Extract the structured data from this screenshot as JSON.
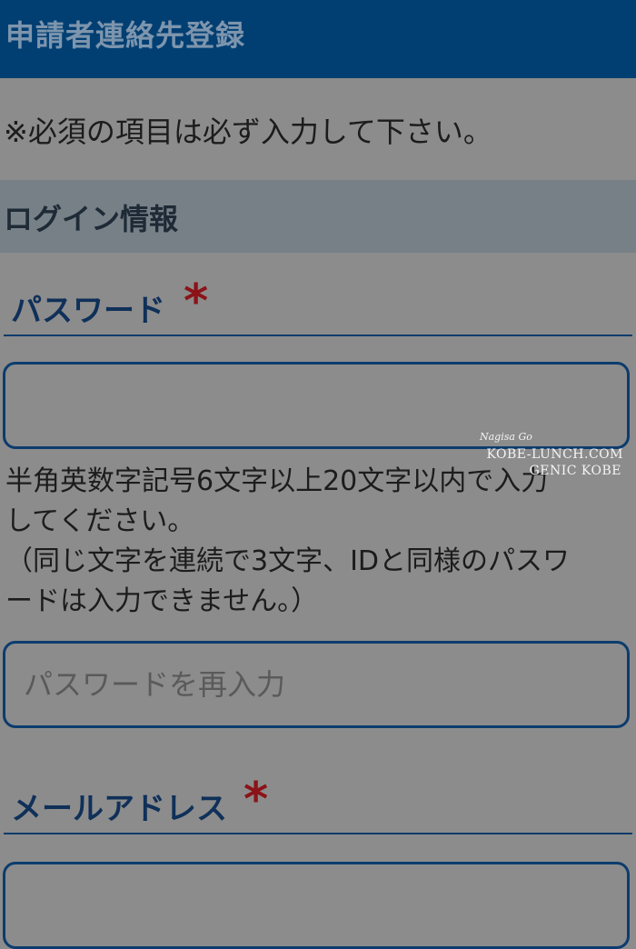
{
  "header": {
    "title": "申請者連絡先登録"
  },
  "notice": "※必須の項目は必ず入力して下さい。",
  "section": {
    "title": "ログイン情報"
  },
  "password": {
    "label": "パスワード",
    "required_mark": "*",
    "value": "",
    "help_lines": [
      "半角英数字記号6文字以上20文字以内で入力",
      "してください。",
      "（同じ文字を連続で3文字、IDと同様のパスワ",
      "ードは入力できません。）"
    ],
    "confirm_placeholder": "パスワードを再入力"
  },
  "email": {
    "label": "メールアドレス",
    "required_mark": "*",
    "value": ""
  },
  "watermark": {
    "signature": "Nagisa Go",
    "line1": "KOBE-LUNCH.COM",
    "line2": "GENIC KOBE"
  },
  "colors": {
    "header_bg": "#013f73",
    "section_bg": "#778087",
    "accent": "#0c3c6e",
    "required": "#8b1318"
  }
}
